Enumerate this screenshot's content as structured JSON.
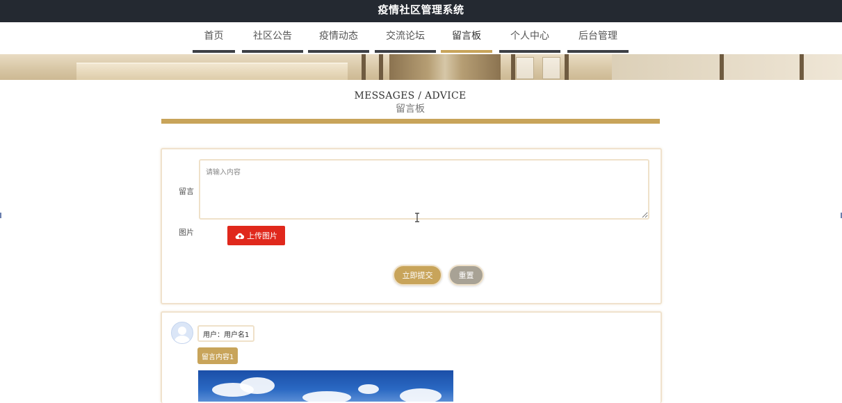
{
  "site": {
    "title": "疫情社区管理系统"
  },
  "nav": {
    "items": [
      {
        "label": "首页",
        "active": false
      },
      {
        "label": "社区公告",
        "active": false
      },
      {
        "label": "疫情动态",
        "active": false
      },
      {
        "label": "交流论坛",
        "active": false
      },
      {
        "label": "留言板",
        "active": true
      },
      {
        "label": "个人中心",
        "active": false
      },
      {
        "label": "后台管理",
        "active": false
      }
    ]
  },
  "section": {
    "title_en": "MESSAGES / ADVICE",
    "title_zh": "留言板"
  },
  "form": {
    "message_label": "留言",
    "message_placeholder": "请输入内容",
    "message_value": "",
    "image_label": "图片",
    "upload_label": "上传图片",
    "submit_label": "立即提交",
    "reset_label": "重置"
  },
  "messages": [
    {
      "user": "用户：用户名1",
      "content": "留言内容1"
    }
  ],
  "icons": {
    "upload": "cloud-upload-icon",
    "avatar": "user-avatar-icon"
  },
  "colors": {
    "accent": "#c8a45a",
    "header_bg": "#242931",
    "upload_button": "#e0281c",
    "reset_button": "#a8a295",
    "nav_bar": "#3c3f45"
  }
}
